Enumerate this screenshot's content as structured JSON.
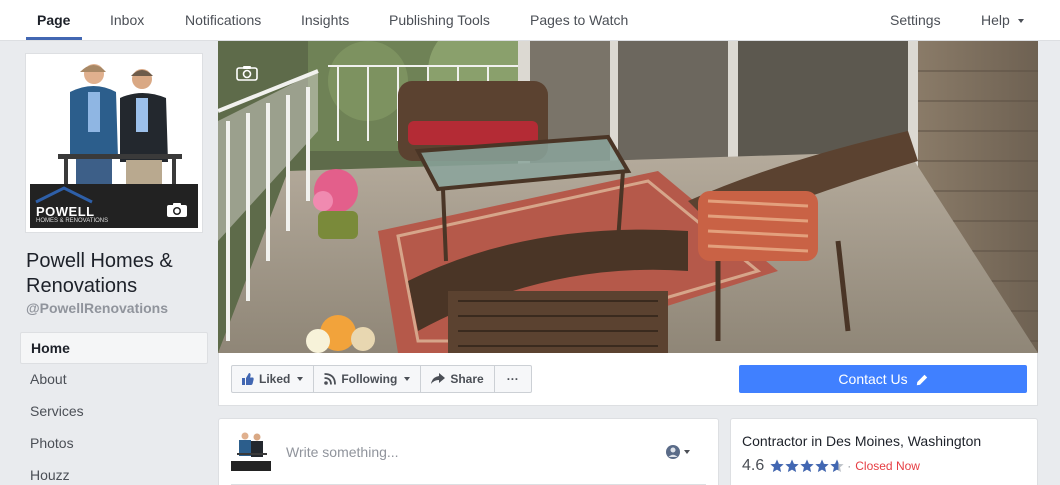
{
  "topnav": {
    "tabs": [
      {
        "label": "Page",
        "active": true
      },
      {
        "label": "Inbox"
      },
      {
        "label": "Notifications"
      },
      {
        "label": "Insights"
      },
      {
        "label": "Publishing Tools"
      },
      {
        "label": "Pages to Watch"
      }
    ],
    "settings_label": "Settings",
    "help_label": "Help"
  },
  "profile": {
    "logo_text": "POWELL",
    "logo_subtext": "HOMES & RENOVATIONS",
    "name": "Powell Homes & Renovations",
    "handle": "@PowellRenovations"
  },
  "sidebar": {
    "items": [
      {
        "label": "Home",
        "active": true
      },
      {
        "label": "About"
      },
      {
        "label": "Services"
      },
      {
        "label": "Photos"
      },
      {
        "label": "Houzz"
      }
    ]
  },
  "actions": {
    "liked_label": "Liked",
    "following_label": "Following",
    "share_label": "Share",
    "more_label": "···",
    "contact_label": "Contact Us"
  },
  "composer": {
    "placeholder": "Write something..."
  },
  "about": {
    "category": "Contractor in Des Moines, Washington",
    "rating": "4.6",
    "rating_value": 4.6,
    "separator": "·",
    "status": "Closed Now"
  },
  "colors": {
    "accent": "#4267b2",
    "button_blue": "#4080ff",
    "closed_red": "#e63d43",
    "star_blue": "#4267b2"
  }
}
